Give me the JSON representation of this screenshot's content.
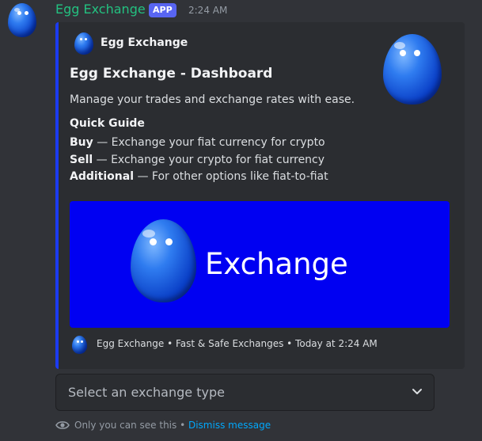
{
  "message": {
    "username": "Egg Exchange",
    "badge": "APP",
    "timestamp": "2:24 AM",
    "avatar_icon": "egg-mascot-icon"
  },
  "embed": {
    "accent_color": "#1c3bf0",
    "author": "Egg Exchange",
    "title": "Egg Exchange - Dashboard",
    "description": "Manage your trades and exchange rates with ease.",
    "guide_heading": "Quick Guide",
    "guide_items": [
      {
        "term": "Buy",
        "text": " — Exchange your fiat currency for crypto"
      },
      {
        "term": "Sell",
        "text": " — Exchange your crypto for fiat currency"
      },
      {
        "term": "Additional",
        "text": " — For other options like fiat-to-fiat"
      }
    ],
    "banner": {
      "background": "#0000f2",
      "text": "Exchange"
    },
    "footer": "Egg Exchange • Fast & Safe Exchanges • Today at 2:24 AM"
  },
  "select": {
    "placeholder": "Select an exchange type"
  },
  "ephemeral": {
    "note": "Only you can see this",
    "separator": " • ",
    "dismiss_label": "Dismiss message"
  }
}
